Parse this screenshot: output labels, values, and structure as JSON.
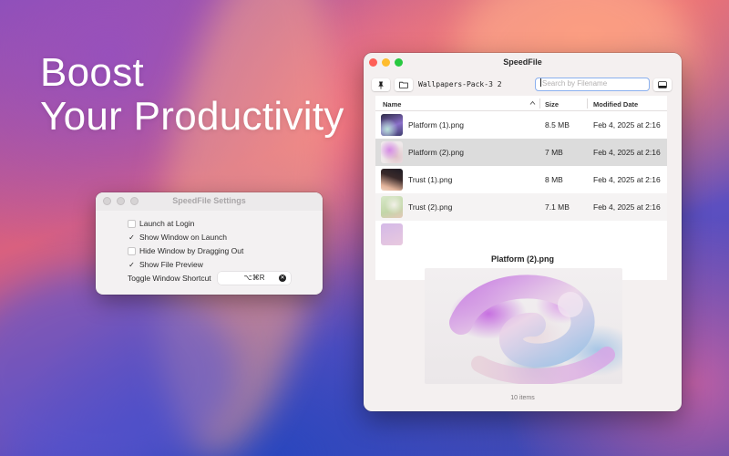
{
  "hero": {
    "line1": "Boost",
    "line2": "Your Productivity"
  },
  "settings_window": {
    "title": "SpeedFile Settings",
    "options": [
      {
        "label": "Launch at Login",
        "checked": false
      },
      {
        "label": "Show Window on Launch",
        "checked": true
      },
      {
        "label": "Hide Window by Dragging Out",
        "checked": false
      },
      {
        "label": "Show File Preview",
        "checked": true
      }
    ],
    "shortcut_label": "Toggle Window Shortcut",
    "shortcut_value": "⌥⌘R"
  },
  "main_window": {
    "title": "SpeedFile",
    "folder_name": "Wallpapers-Pack-3 2",
    "search_placeholder": "Search by Filename",
    "columns": {
      "name": "Name",
      "size": "Size",
      "modified": "Modified Date"
    },
    "rows": [
      {
        "name": "Platform (1).png",
        "size": "8.5 MB",
        "modified": "Feb 4, 2025 at 2:16",
        "selected": false,
        "thumb": "purple-teal"
      },
      {
        "name": "Platform (2).png",
        "size": "7 MB",
        "modified": "Feb 4, 2025 at 2:16",
        "selected": true,
        "thumb": "pink-swirl"
      },
      {
        "name": "Trust (1).png",
        "size": "8 MB",
        "modified": "Feb 4, 2025 at 2:16",
        "selected": false,
        "thumb": "dark-peach"
      },
      {
        "name": "Trust (2).png",
        "size": "7.1 MB",
        "modified": "Feb 4, 2025 at 2:16",
        "selected": false,
        "thumb": "light-green"
      }
    ],
    "preview_title": "Platform (2).png",
    "status": "10 items"
  },
  "icons": {
    "pin": "pin-icon",
    "folder": "folder-icon",
    "sidebar_toggle": "panel-icon",
    "sort": "chevron-up-icon",
    "clear": "clear-icon"
  }
}
